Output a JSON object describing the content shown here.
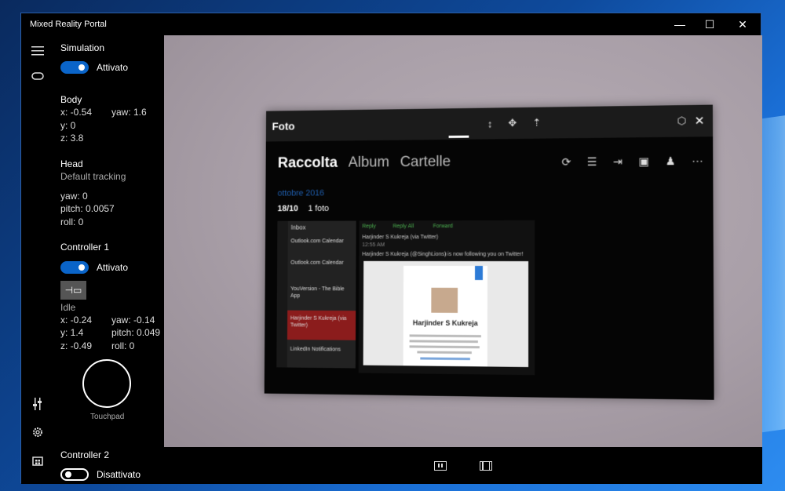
{
  "window": {
    "title": "Mixed Reality Portal",
    "minimize_label": "—",
    "maximize_label": "☐",
    "close_label": "✕"
  },
  "icons": {
    "menu": "hamburger-icon",
    "controller": "gamepad-icon",
    "tools": "tools-icon",
    "settings": "gear-icon",
    "store": "store-icon"
  },
  "simulation": {
    "heading": "Simulation",
    "toggle_label": "Attivato",
    "toggle_on": true
  },
  "body": {
    "heading": "Body",
    "x": "x: -0.54",
    "yaw": "yaw: 1.6",
    "y": "y: 0",
    "z": "z: 3.8"
  },
  "head": {
    "heading": "Head",
    "tracking": "Default tracking",
    "yaw": "yaw: 0",
    "pitch": "pitch: 0.0057",
    "roll": "roll: 0"
  },
  "controller1": {
    "heading": "Controller 1",
    "toggle_label": "Attivato",
    "toggle_on": true,
    "pin_icon": "pin-icon",
    "state": "Idle",
    "x": "x: -0.24",
    "yaw": "yaw: -0.14",
    "y": "y: 1.4",
    "pitch": "pitch: 0.049",
    "z": "z: -0.49",
    "roll": "roll: 0",
    "touchpad_label": "Touchpad"
  },
  "controller2": {
    "heading": "Controller 2",
    "toggle_label": "Disattivato",
    "toggle_on": false
  },
  "photos_app": {
    "title": "Foto",
    "tabs": [
      "Raccolta",
      "Album",
      "Cartelle"
    ],
    "date": "ottobre 2016",
    "day": "18/10",
    "count": "1 foto",
    "mail": {
      "inbox": "Inbox",
      "items": [
        "Outlook.com Calendar",
        "Outlook.com Calendar",
        "YouVersion - The Bible App",
        "Harjinder S Kukreja (via Twitter)",
        "LinkedIn Notifications"
      ],
      "actions": [
        "Reply",
        "Reply All",
        "Forward"
      ],
      "sender": "Harjinder S Kukreja (via Twitter)",
      "time": "12:55 AM",
      "subject": "Harjinder S Kukreja (@SinghLions) is now following you on Twitter!",
      "card_name": "Harjinder S Kukreja"
    }
  },
  "colors": {
    "accent": "#0a64c8",
    "panel_bg": "#000000",
    "viewport_bg": "#a89ea7"
  }
}
